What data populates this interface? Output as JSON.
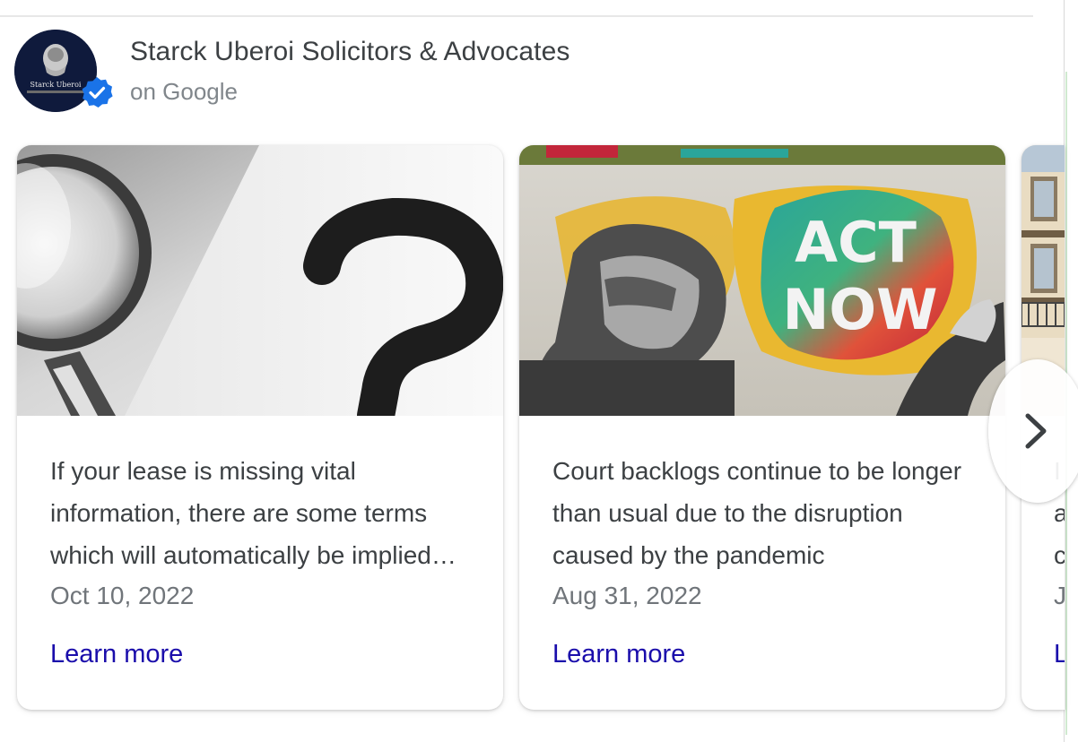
{
  "source": {
    "name": "Starck Uberoi Solicitors & Advocates",
    "subtitle": "on Google",
    "avatar_text": "Starck Uberoi",
    "verified_icon": "verified-check-icon"
  },
  "cards": [
    {
      "image_icon": "magnifier-question-image",
      "text": "If your lease is missing vital information, there are some terms which will automatically be implied into your lease",
      "date": "Oct 10, 2022",
      "link": "Learn more"
    },
    {
      "image_icon": "act-now-mural-image",
      "image_text_1": "ACT",
      "image_text_2": "NOW",
      "text": "Court backlogs continue to be longer than usual due to the disruption caused by the pandemic",
      "date": "Aug 31, 2022",
      "link": "Learn more"
    },
    {
      "image_icon": "building-balconies-image",
      "text_lines": [
        "I",
        "a",
        "c"
      ],
      "date": "J",
      "link": "L"
    }
  ],
  "carousel": {
    "next_icon": "chevron-right-icon"
  },
  "colors": {
    "link": "#1a0dab",
    "text": "#3c4043",
    "muted": "#70757a",
    "verified": "#1a73e8"
  }
}
